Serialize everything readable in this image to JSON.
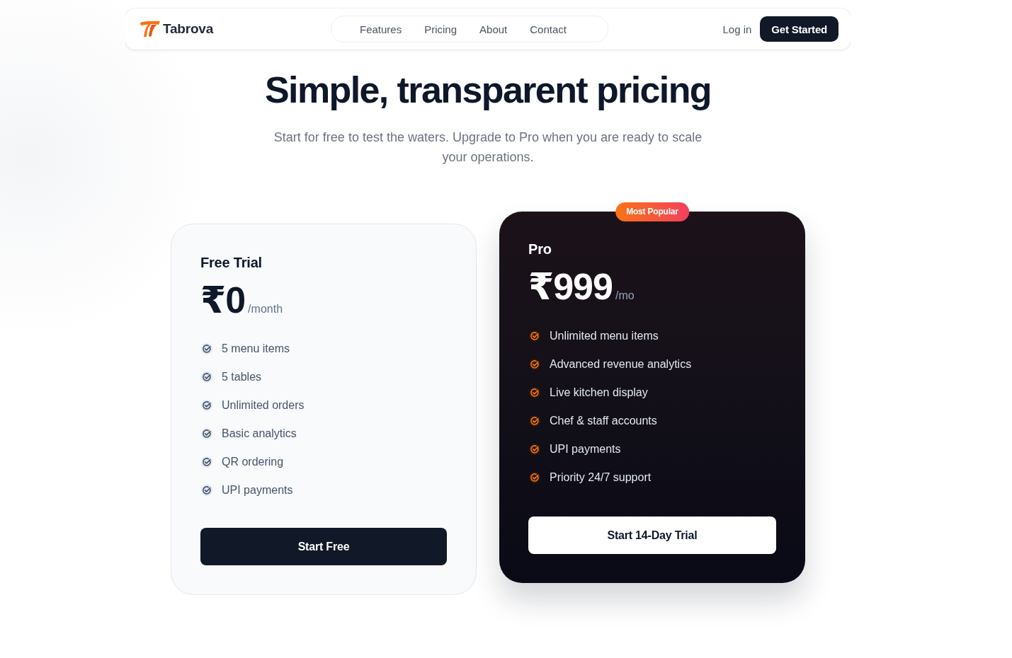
{
  "nav": {
    "brand": "Tabrova",
    "links": [
      "Features",
      "Pricing",
      "About",
      "Contact"
    ],
    "login": "Log in",
    "cta": "Get Started"
  },
  "hero": {
    "title": "Simple, transparent pricing",
    "subtitle": "Start for free to test the waters. Upgrade to Pro when you are ready to scale your operations."
  },
  "plans": [
    {
      "kind": "standard",
      "name": "Free Trial",
      "price": "₹0",
      "period": "/month",
      "features": [
        "5 menu items",
        "5 tables",
        "Unlimited orders",
        "Basic analytics",
        "QR ordering",
        "UPI payments"
      ],
      "button": "Start Free"
    },
    {
      "kind": "featured",
      "badge": "Most Popular",
      "name": "Pro",
      "price": "₹999",
      "period": "/mo",
      "features": [
        "Unlimited menu items",
        "Advanced revenue analytics",
        "Live kitchen display",
        "Chef & staff accounts",
        "UPI payments",
        "Priority 24/7 support"
      ],
      "button": "Start 14-Day Trial"
    }
  ]
}
